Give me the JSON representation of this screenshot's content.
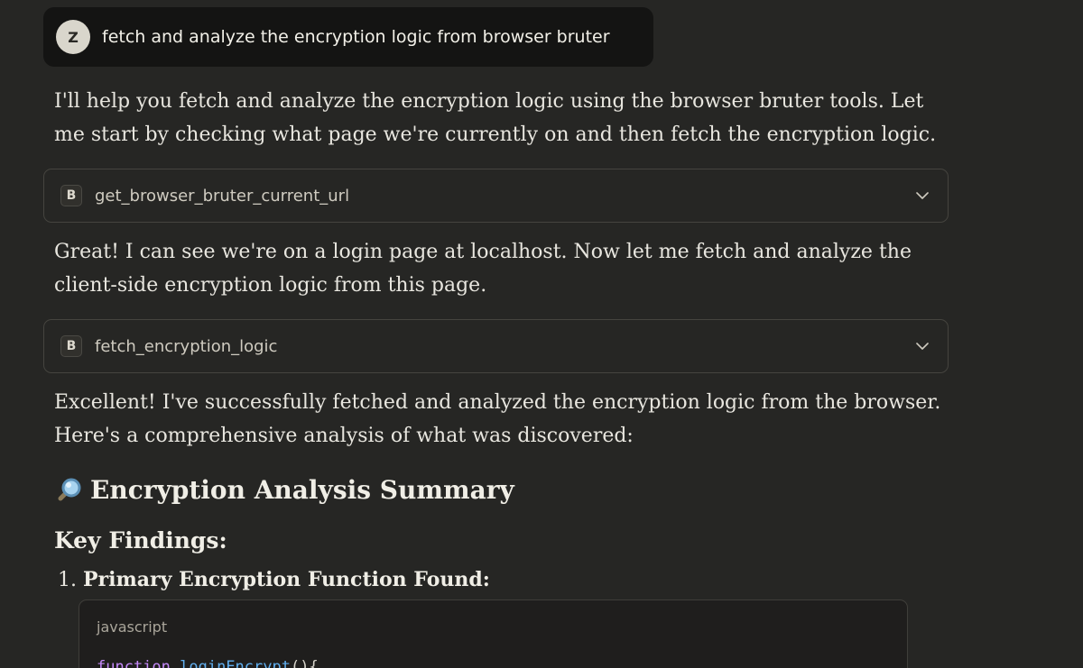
{
  "user_message": {
    "avatar_letter": "Z",
    "text": "fetch and analyze the encryption logic from browser bruter"
  },
  "paragraphs": [
    "I'll help you fetch and analyze the encryption logic using the browser bruter tools. Let me start by checking what page we're currently on and then fetch the encryption logic.",
    "Great! I can see we're on a login page at localhost. Now let me fetch and analyze the client-side encryption logic from this page.",
    "Excellent! I've successfully fetched and analyzed the encryption logic from the browser. Here's a comprehensive analysis of what was discovered:"
  ],
  "tool_calls": [
    {
      "badge": "B",
      "name": "get_browser_bruter_current_url",
      "icon": "chevron-down-icon"
    },
    {
      "badge": "B",
      "name": "fetch_encryption_logic",
      "icon": "chevron-down-icon"
    }
  ],
  "summary_heading": {
    "icon": "magnifying-glass-icon",
    "text": "Encryption Analysis Summary"
  },
  "key_findings_heading": "Key Findings:",
  "findings": [
    {
      "number": "1.",
      "title": "Primary Encryption Function Found:"
    }
  ],
  "code_block": {
    "language": "javascript",
    "keyword": "function",
    "function_name": "loginEncrypt",
    "punctuation": "(){"
  },
  "colors": {
    "background": "#262624",
    "user_bubble": "#141413",
    "text": "#e8e6df",
    "code_keyword": "#c58af9",
    "code_function": "#61afef"
  }
}
